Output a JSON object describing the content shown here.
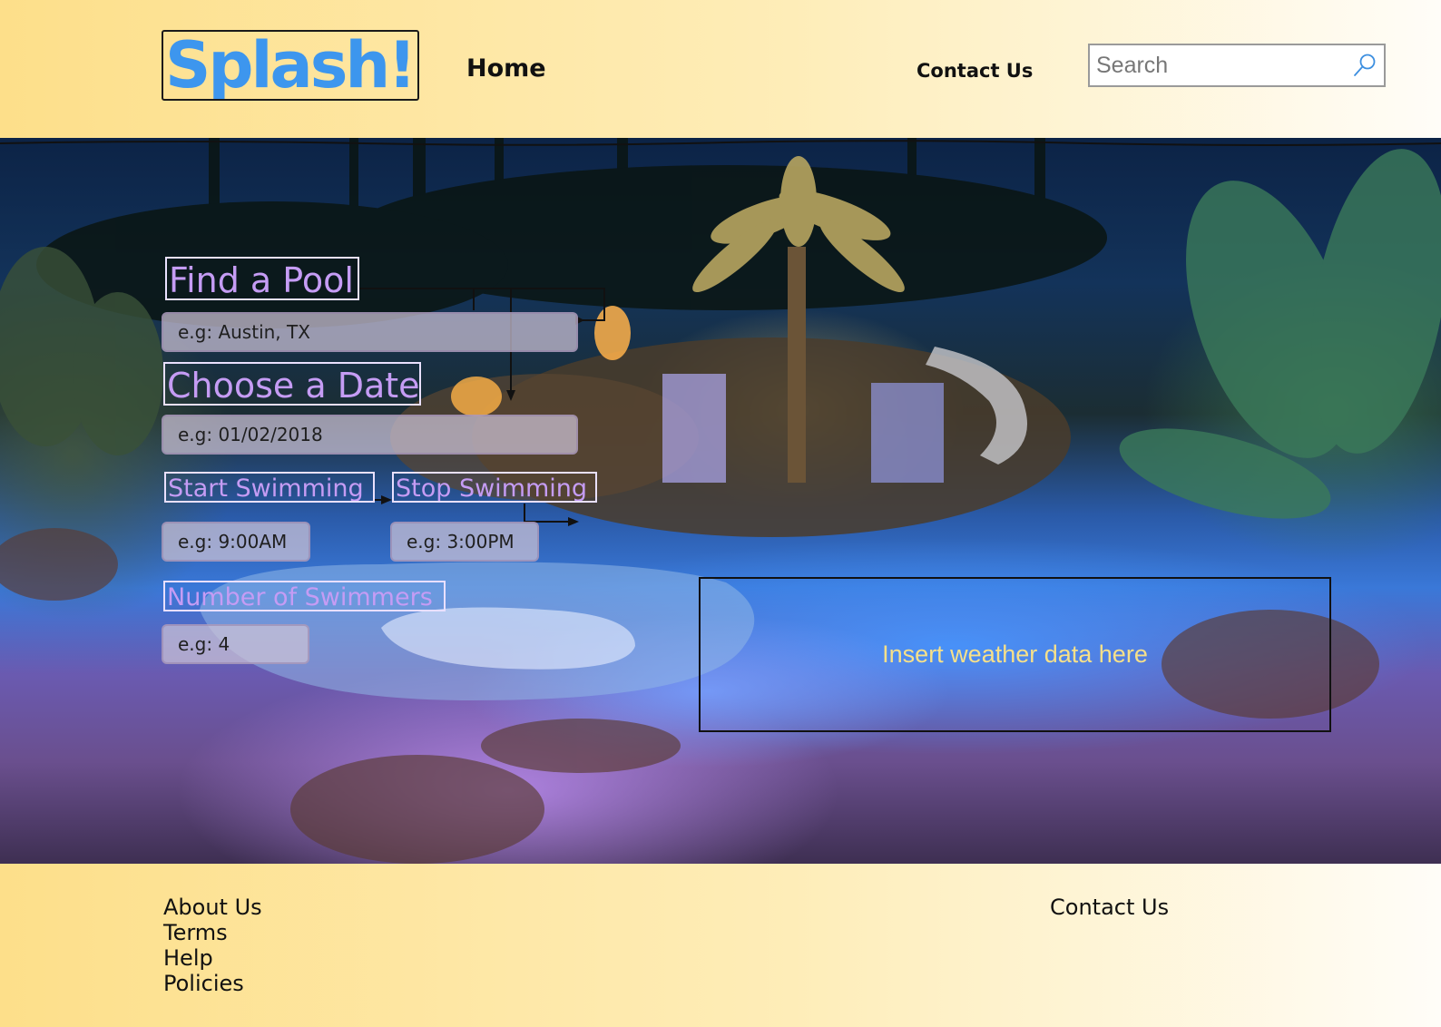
{
  "header": {
    "logo_text": "Splash!",
    "nav": {
      "home_label": "Home",
      "contact_label": "Contact Us"
    },
    "search": {
      "placeholder": "Search",
      "value": ""
    }
  },
  "form": {
    "find_pool_label": "Find a Pool",
    "location_placeholder": "e.g: Austin, TX",
    "date_label": "Choose a Date",
    "date_placeholder": "e.g: 01/02/2018",
    "start_label": "Start Swimming",
    "start_placeholder": "e.g: 9:00AM",
    "stop_label": "Stop Swimming",
    "stop_placeholder": "e.g: 3:00PM",
    "swimmers_label": "Number of Swimmers",
    "swimmers_placeholder": "e.g: 4"
  },
  "weather": {
    "placeholder_text": "Insert weather data here"
  },
  "footer": {
    "links": [
      "About Us",
      "Terms",
      "Help",
      "Policies"
    ],
    "contact_label": "Contact Us"
  },
  "colors": {
    "logo": "#3d96ee",
    "label_text": "#c59cf4",
    "weather_text": "#f6e08a",
    "header_gradient_start": "#fddf8a",
    "header_gradient_end": "#fffdf8"
  }
}
